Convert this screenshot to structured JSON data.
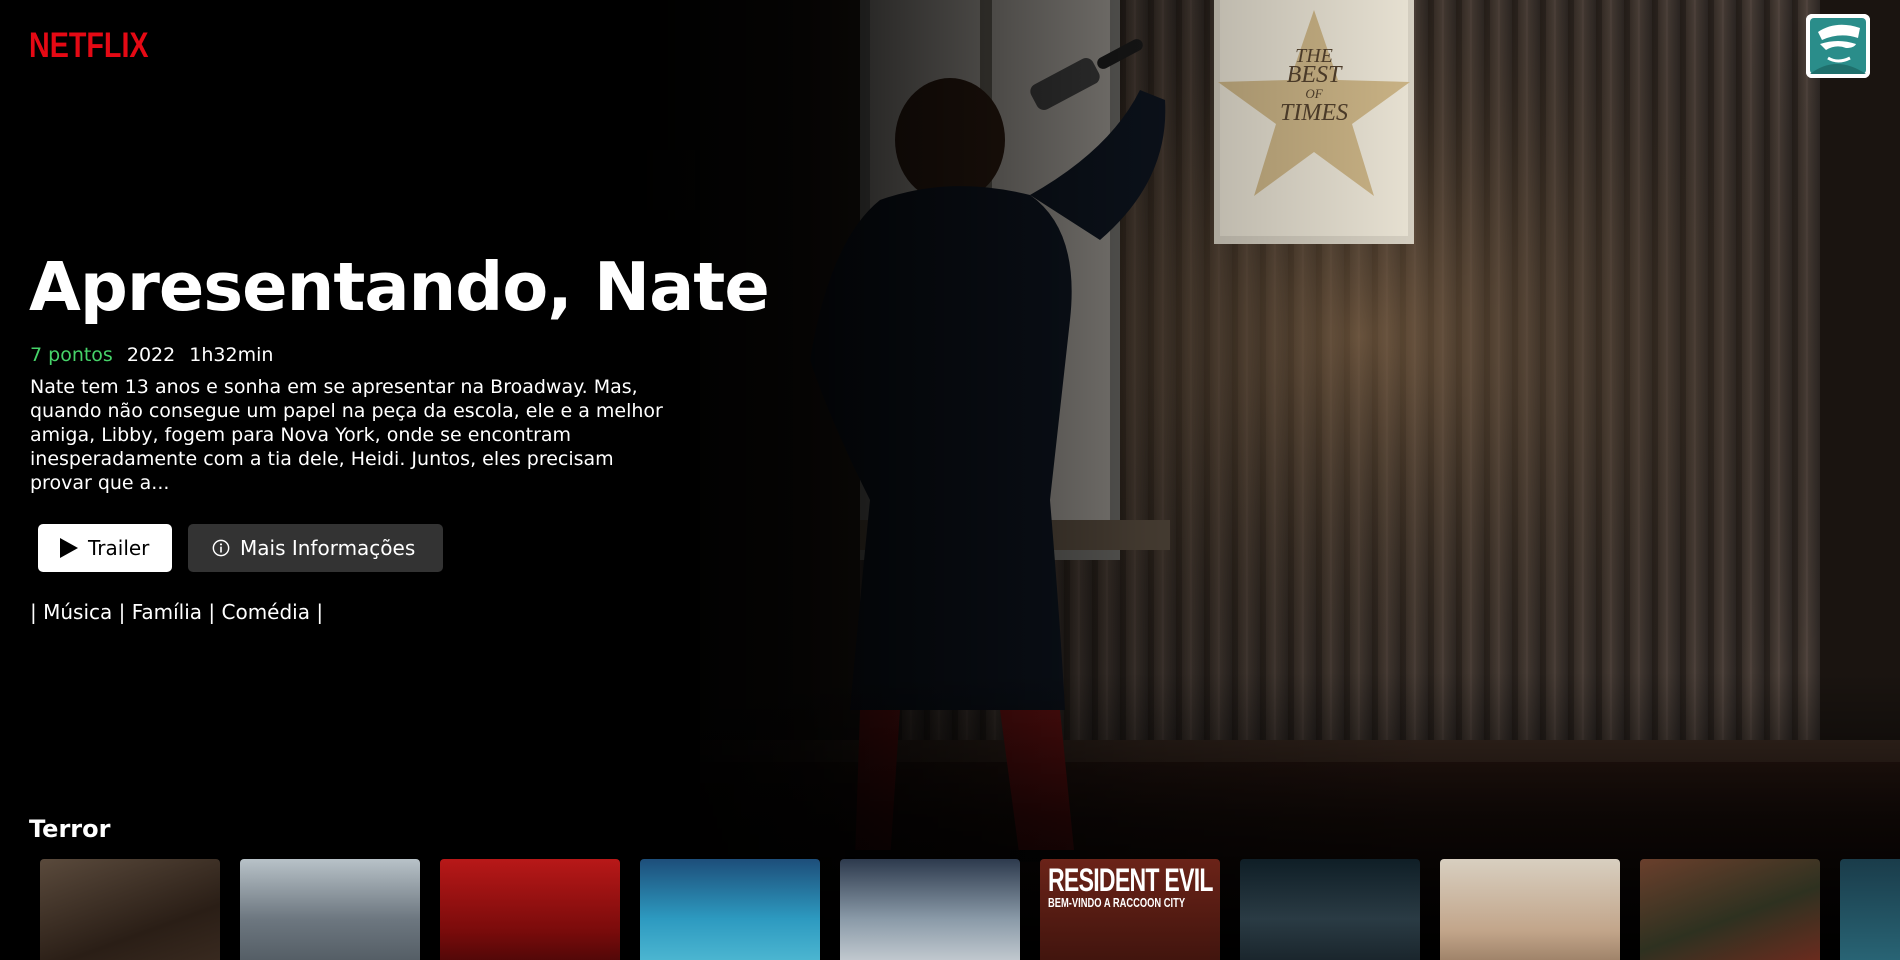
{
  "header": {
    "logo_text": "NETFLIX",
    "logo_color": "#e50914",
    "avatar_icon": "user-avatar-icon"
  },
  "feature": {
    "title": "Apresentando, Nate",
    "points": "7 pontos",
    "year": "2022",
    "duration": "1h32min",
    "description": "Nate tem 13 anos e sonha em se apresentar na Broadway. Mas, quando não consegue um papel na peça da escola, ele e a melhor amiga, Libby, fogem para Nova York, onde se encontram inesperadamente com a tia dele, Heidi. Juntos, eles precisam provar que a...",
    "trailer_label": "Trailer",
    "trailer_icon": "play-icon",
    "info_label": "Mais Informações",
    "info_icon": "info-icon",
    "genres": "| Música | Família | Comédia |",
    "points_color": "#46d369",
    "poster_text": {
      "line1": "THE",
      "line2": "BEST",
      "line3": "OF",
      "line4": "TIMES"
    }
  },
  "rows": [
    {
      "title": "Terror",
      "posters": [
        {
          "name": "poster-1",
          "text": ""
        },
        {
          "name": "poster-2",
          "text": ""
        },
        {
          "name": "poster-3",
          "text": ""
        },
        {
          "name": "poster-4",
          "text": ""
        },
        {
          "name": "poster-5",
          "text": ""
        },
        {
          "name": "poster-6",
          "text": "RESIDENT EVIL",
          "subtitle": "BEM-VINDO A RACCOON CITY"
        },
        {
          "name": "poster-7",
          "text": ""
        },
        {
          "name": "poster-8",
          "text": ""
        },
        {
          "name": "poster-9",
          "text": ""
        },
        {
          "name": "poster-10",
          "text": ""
        }
      ]
    }
  ]
}
